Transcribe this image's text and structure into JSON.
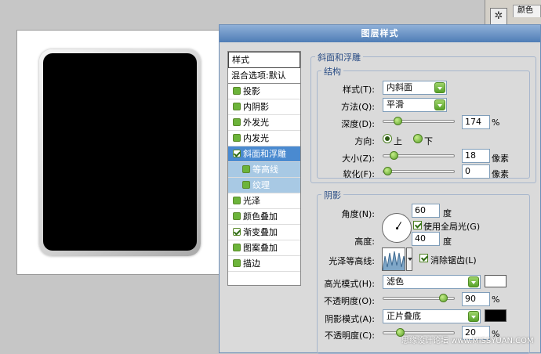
{
  "palette": {
    "tab_label": "颜色",
    "icon": "snowflake-icon"
  },
  "dialog": {
    "title": "图层样式",
    "styles_list": {
      "header": "样式",
      "blend_options": "混合选项:默认",
      "items": [
        {
          "label": "投影",
          "checked": false
        },
        {
          "label": "内阴影",
          "checked": false
        },
        {
          "label": "外发光",
          "checked": false
        },
        {
          "label": "内发光",
          "checked": false
        },
        {
          "label": "斜面和浮雕",
          "checked": true,
          "selected": true
        },
        {
          "label": "等高线",
          "checked": false,
          "sub": true
        },
        {
          "label": "纹理",
          "checked": false,
          "sub": true
        },
        {
          "label": "光泽",
          "checked": false
        },
        {
          "label": "颜色叠加",
          "checked": false
        },
        {
          "label": "渐变叠加",
          "checked": true
        },
        {
          "label": "图案叠加",
          "checked": false
        },
        {
          "label": "描边",
          "checked": false
        }
      ]
    },
    "bevel": {
      "group_title": "斜面和浮雕",
      "structure_title": "结构",
      "style_label": "样式(T):",
      "style_value": "内斜面",
      "technique_label": "方法(Q):",
      "technique_value": "平滑",
      "depth_label": "深度(D):",
      "depth_value": "174",
      "depth_unit": "%",
      "depth_fraction": 0.17,
      "direction_label": "方向:",
      "direction_up": "上",
      "direction_down": "下",
      "size_label": "大小(Z):",
      "size_value": "18",
      "size_unit": "像素",
      "size_fraction": 0.1,
      "soften_label": "软化(F):",
      "soften_value": "0",
      "soften_unit": "像素",
      "soften_fraction": 0.0
    },
    "shading": {
      "group_title": "阴影",
      "angle_label": "角度(N):",
      "angle_value": "60",
      "angle_unit": "度",
      "global_light_label": "使用全局光(G)",
      "altitude_label": "高度:",
      "altitude_value": "40",
      "altitude_unit": "度",
      "gloss_contour_label": "光泽等高线:",
      "anti_alias_label": "消除锯齿(L)",
      "highlight_mode_label": "高光模式(H):",
      "highlight_mode_value": "滤色",
      "highlight_color": "#ffffff",
      "highlight_opacity_label": "不透明度(O):",
      "highlight_opacity_value": "90",
      "highlight_opacity_unit": "%",
      "highlight_opacity_fraction": 0.9,
      "shadow_mode_label": "阴影模式(A):",
      "shadow_mode_value": "正片叠底",
      "shadow_color": "#000000",
      "shadow_opacity_label": "不透明度(C):",
      "shadow_opacity_value": "20",
      "shadow_opacity_unit": "%",
      "shadow_opacity_fraction": 0.2
    }
  },
  "watermark": "思缘设计论坛 www.MISSYUAN.COM"
}
